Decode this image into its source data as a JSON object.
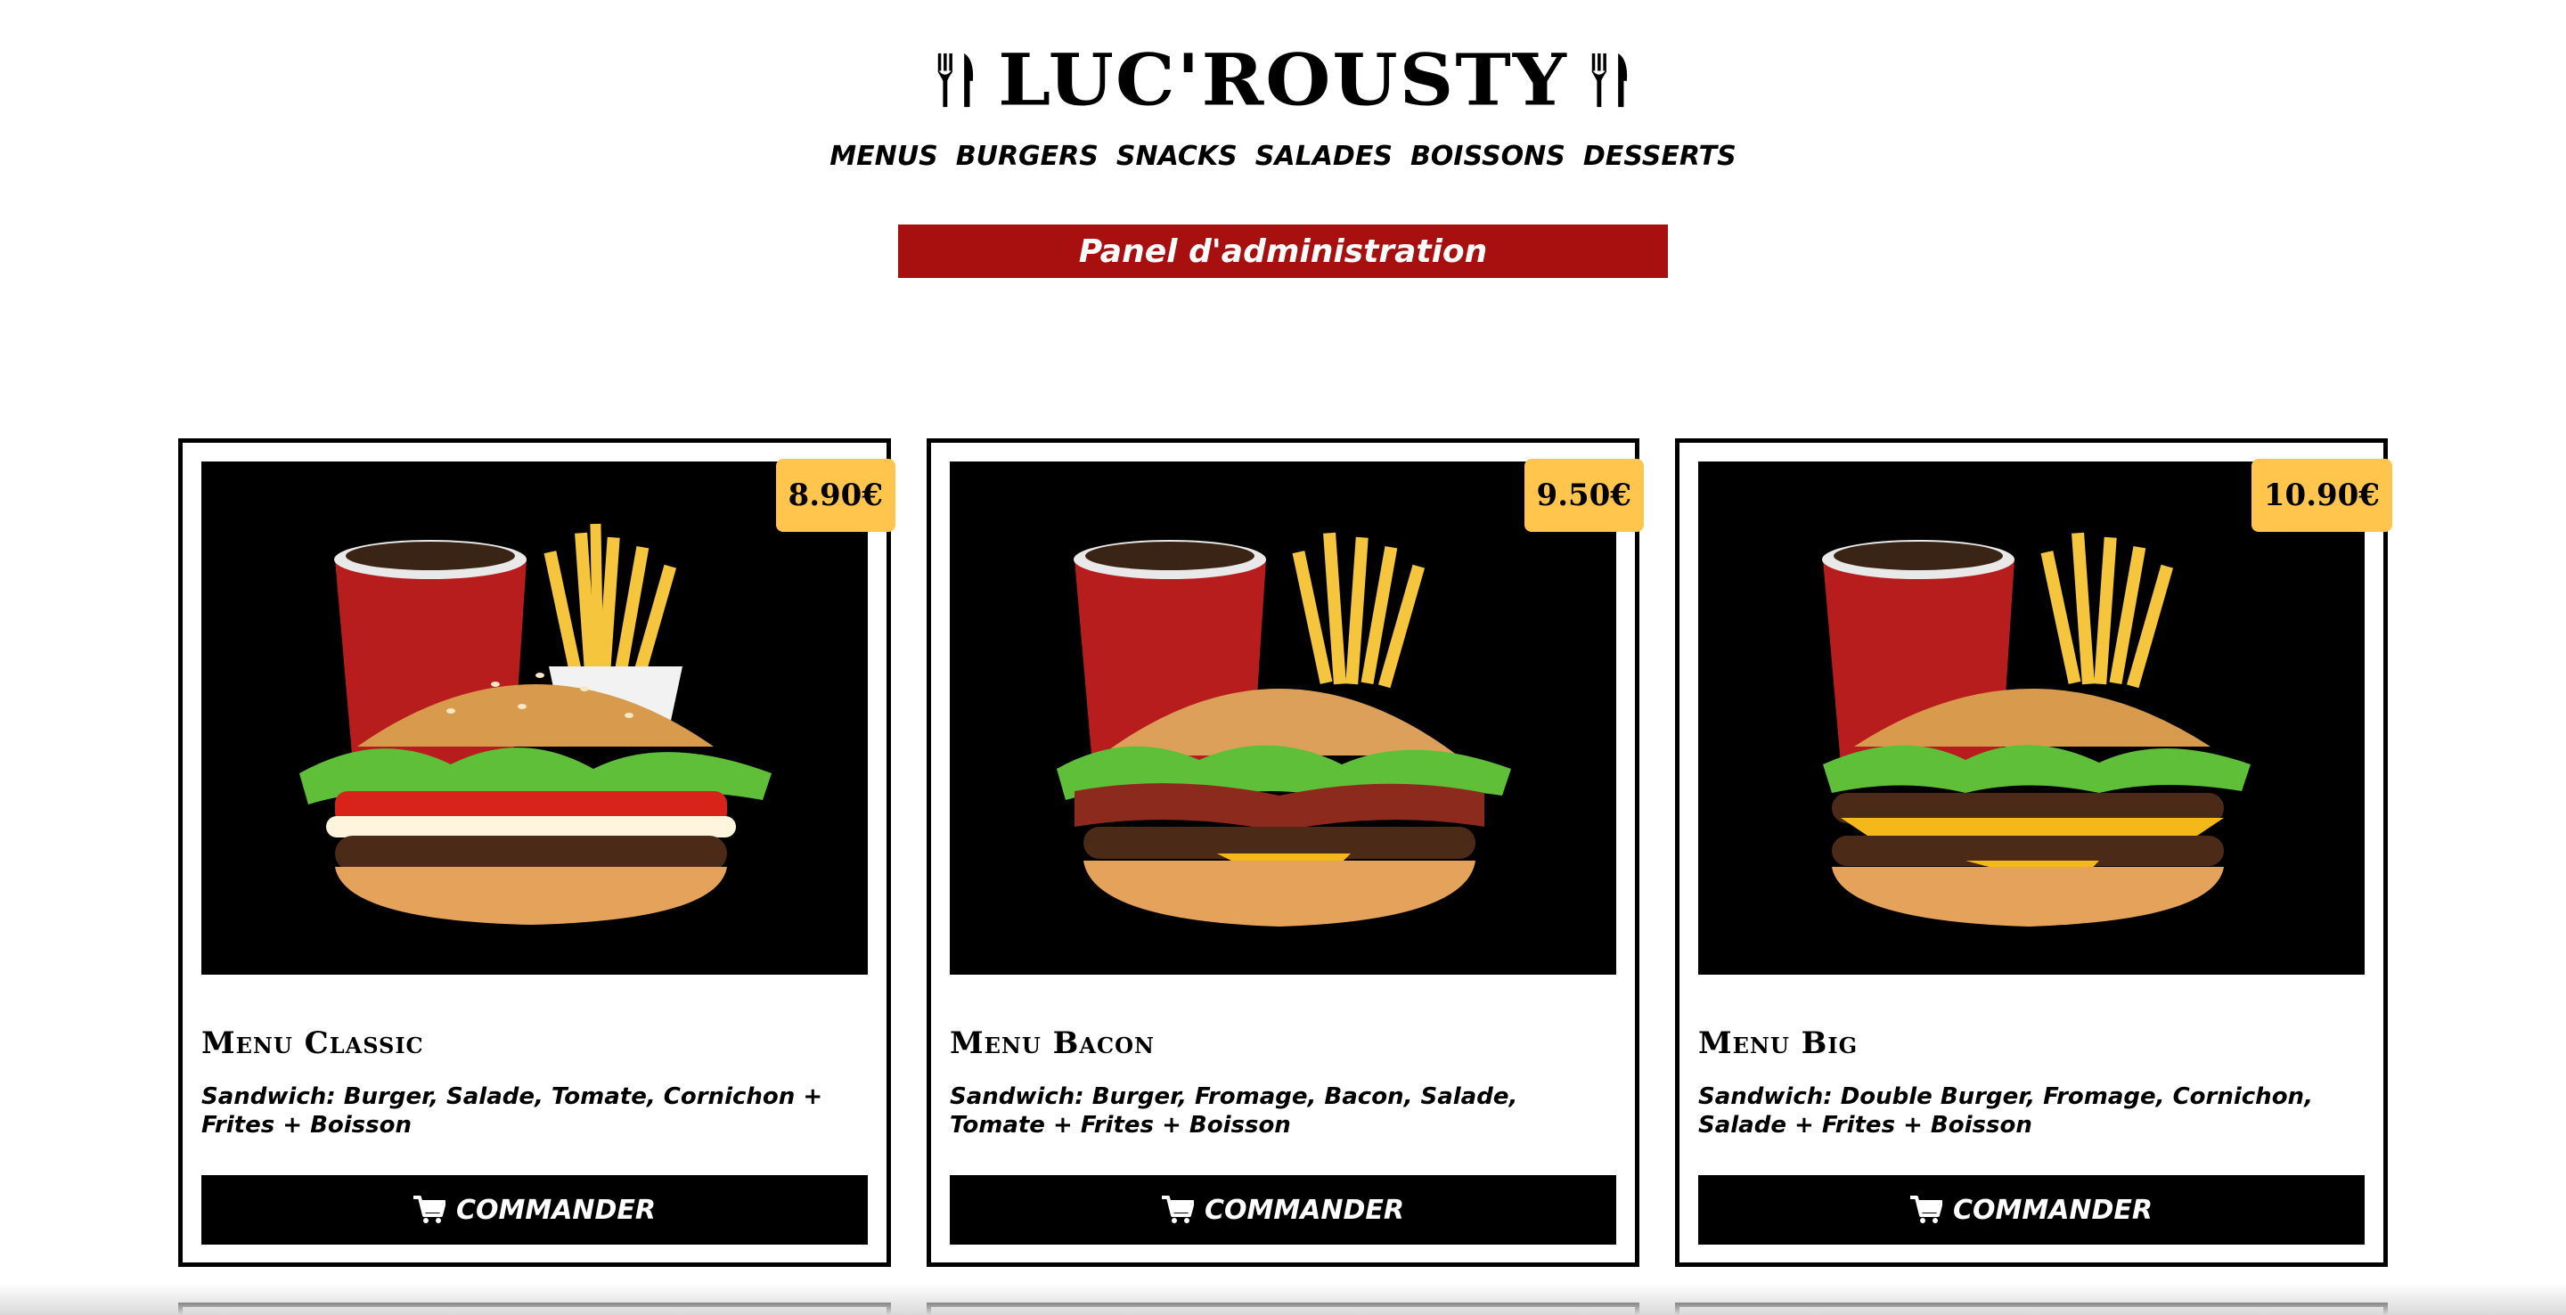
{
  "header": {
    "logo": "LUC'ROUSTY"
  },
  "nav": {
    "items": [
      "MENUS",
      "BURGERS",
      "SNACKS",
      "SALADES",
      "BOISSONS",
      "DESSERTS"
    ]
  },
  "admin": {
    "label": "Panel d'administration"
  },
  "products": [
    {
      "name": "Menu Classic",
      "price": "8.90€",
      "description": "Sandwich: Burger, Salade, Tomate, Cornichon + Frites + Boisson",
      "button": "COMMANDER"
    },
    {
      "name": "Menu Bacon",
      "price": "9.50€",
      "description": "Sandwich: Burger, Fromage, Bacon, Salade, Tomate + Frites + Boisson",
      "button": "COMMANDER"
    },
    {
      "name": "Menu Big",
      "price": "10.90€",
      "description": "Sandwich: Double Burger, Fromage, Cornichon, Salade + Frites + Boisson",
      "button": "COMMANDER"
    }
  ],
  "colors": {
    "accent": "#a81010",
    "price_badge": "#ffc54d",
    "button": "#000000"
  },
  "icons": [
    "cutlery-icon",
    "cart-icon"
  ]
}
